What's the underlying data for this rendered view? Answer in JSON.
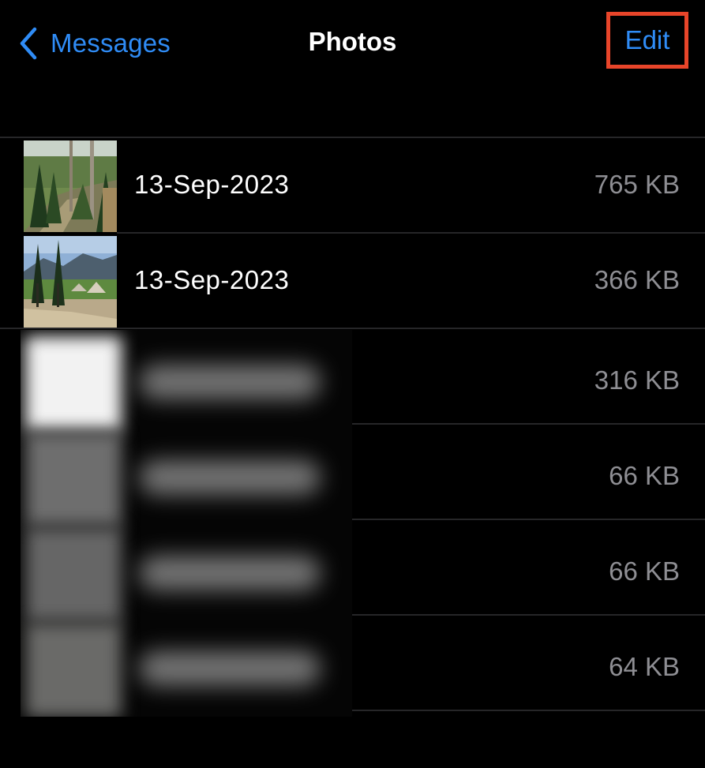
{
  "nav": {
    "back_label": "Messages",
    "title": "Photos",
    "edit_label": "Edit"
  },
  "colors": {
    "accent": "#2f8cf6",
    "highlight_box": "#e8452a",
    "secondary_text": "#8e8e93",
    "background": "#000000"
  },
  "icons": {
    "back": "chevron-left-icon"
  },
  "rows": [
    {
      "date": "13-Sep-2023",
      "size": "765 KB"
    },
    {
      "date": "13-Sep-2023",
      "size": "366 KB"
    },
    {
      "date": "",
      "size": "316 KB"
    },
    {
      "date": "",
      "size": "66 KB"
    },
    {
      "date": "",
      "size": "66 KB"
    },
    {
      "date": "",
      "size": "64 KB"
    }
  ]
}
